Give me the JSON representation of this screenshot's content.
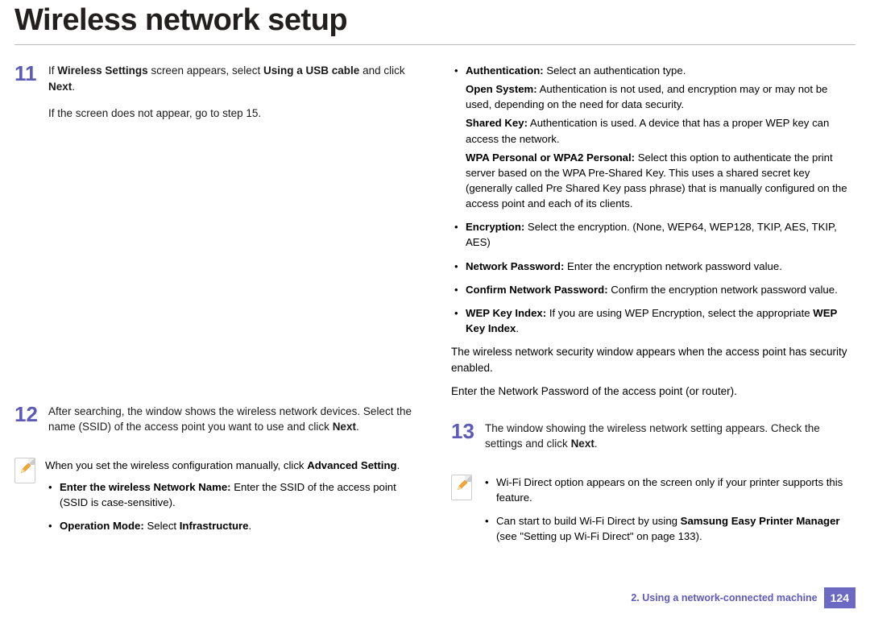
{
  "title": "Wireless network setup",
  "left": {
    "step11": {
      "num": "11",
      "line1a": "If ",
      "line1b": "Wireless Settings",
      "line1c": " screen appears, select ",
      "line1d": "Using a USB cable",
      "line1e": " and click ",
      "line1f": "Next",
      "line1g": ".",
      "line2": "If the screen does not appear, go to step 15."
    },
    "step12": {
      "num": "12",
      "text_a": "After searching, the window shows the wireless network devices. Select the name (SSID) of the access point you want to use and click ",
      "text_b": "Next",
      "text_c": "."
    },
    "note": {
      "intro_a": "When you set the wireless configuration manually, click ",
      "intro_b": "Advanced Setting",
      "intro_c": ".",
      "b1_a": "Enter the wireless Network Name:",
      "b1_b": " Enter the SSID of the access point (SSID is case-sensitive).",
      "b2_a": "Operation Mode:",
      "b2_b": " Select ",
      "b2_c": "Infrastructure",
      "b2_d": "."
    }
  },
  "right": {
    "auth": {
      "t1a": "Authentication:",
      "t1b": " Select an authentication type.",
      "os_a": "Open System:",
      "os_b": " Authentication is not used, and encryption may or may not be used, depending on the need for data security.",
      "sk_a": "Shared Key:",
      "sk_b": " Authentication is used. A device that has a proper WEP key can access the network.",
      "wpa_a": "WPA Personal or WPA2 Personal:",
      "wpa_b": " Select this option to authenticate the print server based on the WPA Pre-Shared Key. This uses a shared secret key (generally called Pre Shared Key pass phrase) that is manually configured on the access point and each of its clients."
    },
    "enc_a": "Encryption:",
    "enc_b": " Select the encryption. (None, WEP64, WEP128, TKIP, AES, TKIP, AES)",
    "np_a": "Network Password:",
    "np_b": " Enter the encryption network password value.",
    "cnp_a": "Confirm Network Password:",
    "cnp_b": " Confirm the encryption network password value.",
    "wep_a": "WEP Key Index:",
    "wep_b": " If you are using WEP Encryption, select the appropriate ",
    "wep_c": "WEP Key Index",
    "wep_d": ".",
    "tail1": "The wireless network security window appears when the access point has security enabled.",
    "tail2": "Enter the Network Password of the access point (or router).",
    "step13": {
      "num": "13",
      "text_a": "The window showing the wireless network setting appears. Check the settings and click ",
      "text_b": "Next",
      "text_c": "."
    },
    "note2": {
      "b1": "Wi-Fi Direct option appears on the screen only if your printer supports this feature.",
      "b2_a": "Can start to build Wi-Fi Direct by using ",
      "b2_b": "Samsung Easy Printer Manager",
      "b2_c": " (see \"Setting up Wi-Fi Direct\" on page 133)."
    }
  },
  "footer": {
    "chapter": "2.  Using a network-connected machine",
    "page": "124"
  }
}
